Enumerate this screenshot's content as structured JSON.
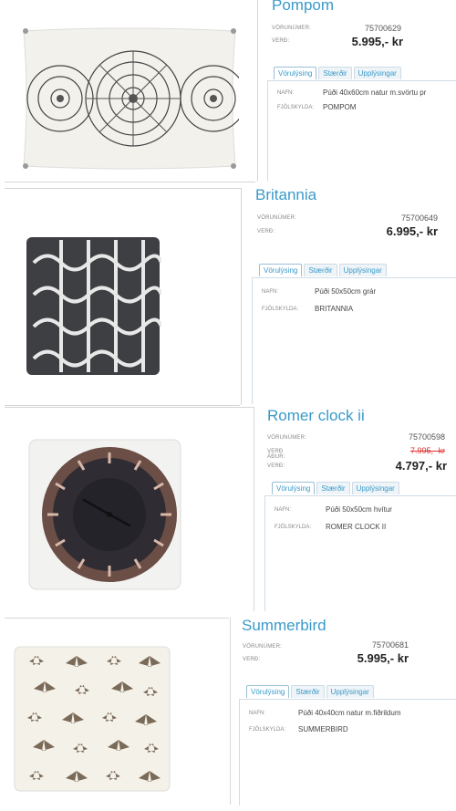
{
  "products": [
    {
      "name": "Pompom",
      "sku_label": "VÖRUNÚMER:",
      "sku": "75700629",
      "price_label": "VERÐ:",
      "price": "5.995,- kr",
      "tabs": [
        "Vörulýsing",
        "Stærðir",
        "Upplýsingar"
      ],
      "name_label": "NAFN:",
      "description": "Púði 40x60cm natur m.svörtu pr",
      "family_label": "FJÖLSKYLDA:",
      "family": "POMPOM"
    },
    {
      "name": "Britannia",
      "sku_label": "VÖRUNÚMER:",
      "sku": "75700649",
      "price_label": "VERÐ:",
      "price": "6.995,- kr",
      "tabs": [
        "Vörulýsing",
        "Stærðir",
        "Upplýsingar"
      ],
      "name_label": "NAFN:",
      "description": "Púði 50x50cm grár",
      "family_label": "FJÖLSKYLDA:",
      "family": "BRITANNIA"
    },
    {
      "name": "Romer clock ii",
      "sku_label": "VÖRUNÚMER:",
      "sku": "75700598",
      "old_price_label": "VERÐ ÁÐUR:",
      "old_price": "7.995,- kr",
      "price_label": "VERÐ:",
      "price": "4.797,- kr",
      "tabs": [
        "Vörulýsing",
        "Stærðir",
        "Upplýsingar"
      ],
      "name_label": "NAFN:",
      "description": "Púði 50x50cm hvítur",
      "family_label": "FJÖLSKYLDA:",
      "family": "ROMER CLOCK II"
    },
    {
      "name": "Summerbird",
      "sku_label": "VÖRUNÚMER:",
      "sku": "75700681",
      "price_label": "VERÐ:",
      "price": "5.995,- kr",
      "tabs": [
        "Vörulýsing",
        "Stærðir",
        "Upplýsingar"
      ],
      "name_label": "NAFN:",
      "description": "Púði 40x40cm natur m.fiðrildum",
      "family_label": "FJÖLSKYLDA:",
      "family": "SUMMERBIRD"
    }
  ],
  "colors": {
    "accent": "#3a9ac9",
    "old_price": "#dd3333"
  }
}
